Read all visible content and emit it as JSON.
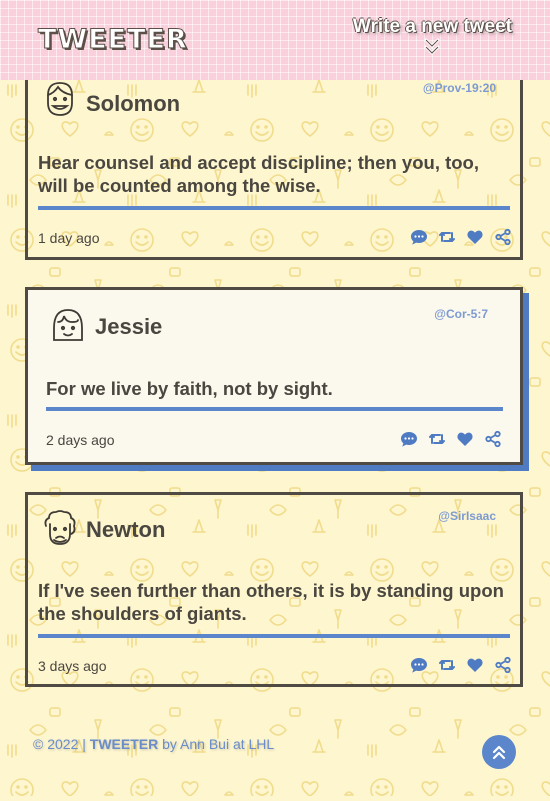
{
  "header": {
    "brand": "TWEETER",
    "compose_label": "Write a new tweet",
    "compose_icon": "double-chevron-down-icon"
  },
  "tweets": [
    {
      "name": "Solomon",
      "handle": "@Prov-19:20",
      "text": "Hear counsel and accept discipline; then you, too, will be counted among the wise.",
      "time": "1 day ago",
      "avatar": "smiling-man-avatar-icon"
    },
    {
      "name": "Jessie",
      "handle": "@Cor-5:7",
      "text": "For we live by faith, not by sight.",
      "time": "2 days ago",
      "avatar": "girl-bangs-avatar-icon"
    },
    {
      "name": "Newton",
      "handle": "@SirIsaac",
      "text": "If I've seen further than others, it is by standing upon the shoulders of giants.",
      "time": "3 days ago",
      "avatar": "curly-hair-man-avatar-icon"
    }
  ],
  "actions": [
    "comment-icon",
    "retweet-icon",
    "heart-icon",
    "share-icon"
  ],
  "footer": {
    "copyright": "© 2022 |",
    "brand": "TWEETER",
    "by": "by Ann Bui at LHL"
  },
  "colors": {
    "background": "#fdf6cf",
    "header": "#fbd0dd",
    "accent": "#5b86cc",
    "border": "#4f4a44",
    "text": "#4a4640"
  }
}
